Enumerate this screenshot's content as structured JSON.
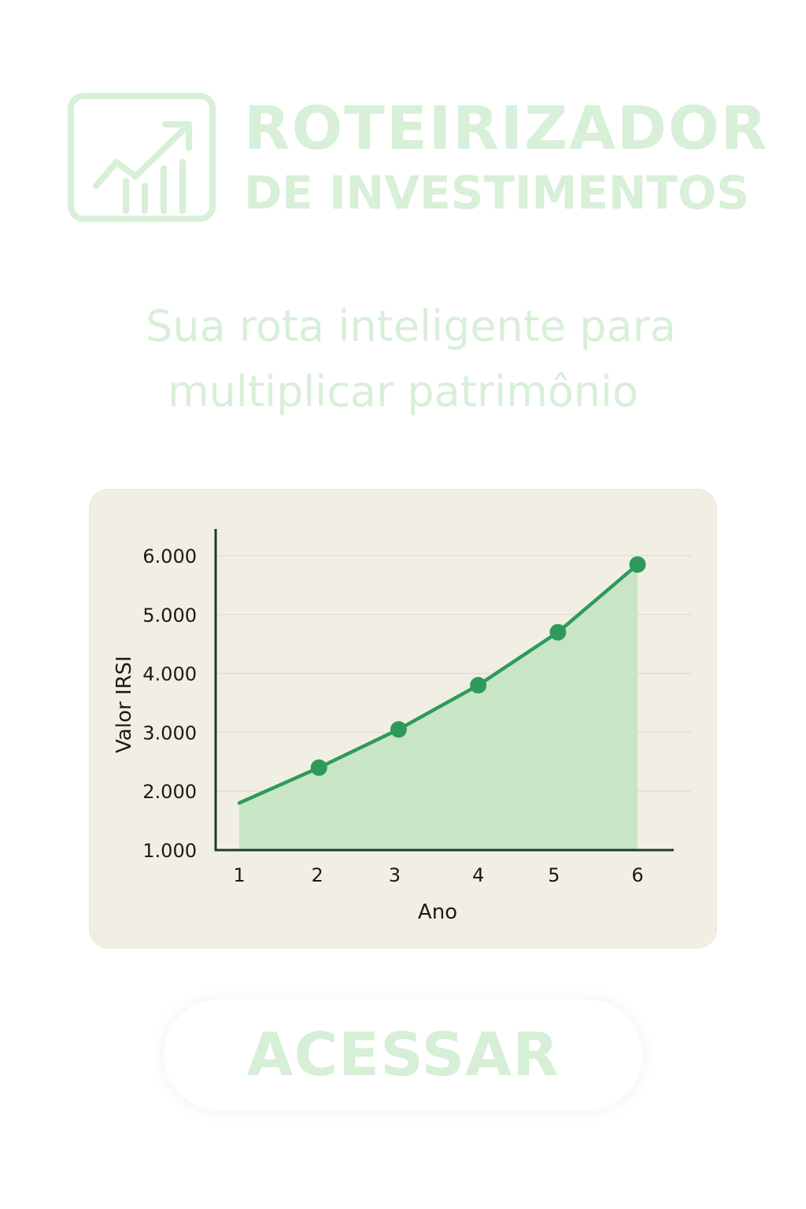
{
  "brand": {
    "line1": "ROTEIRIZADOR",
    "line2": "DE INVESTIMENTOS",
    "logo_icon": "growth-chart-icon",
    "color": "#d8efd8"
  },
  "tagline": {
    "line1": "Sua rota inteligente para",
    "line2": "multiplicar patrimônio"
  },
  "chart_data": {
    "type": "area",
    "title": "",
    "xlabel": "Ano",
    "ylabel": "Valor IRSI",
    "x": [
      1,
      2,
      3,
      4,
      5,
      6
    ],
    "x_tick_labels": [
      "1",
      "2",
      "3",
      "4",
      "5",
      "6"
    ],
    "y_tick_labels": [
      "1.000",
      "2.000",
      "3.000",
      "4.000",
      "5.000",
      "6.000"
    ],
    "ylim": [
      1000,
      6000
    ],
    "grid": true,
    "series": [
      {
        "values": [
          1800,
          2400,
          3050,
          3800,
          4700,
          5850
        ],
        "markers": [
          false,
          true,
          true,
          true,
          true,
          true
        ],
        "color": "#2e9a5a",
        "fill_color": "#c8e6c6"
      }
    ],
    "axis_color": "#1e3a2e",
    "grid_color": "#e2e0d4"
  },
  "cta": {
    "label": "ACESSAR",
    "color": "#d6efd6"
  }
}
